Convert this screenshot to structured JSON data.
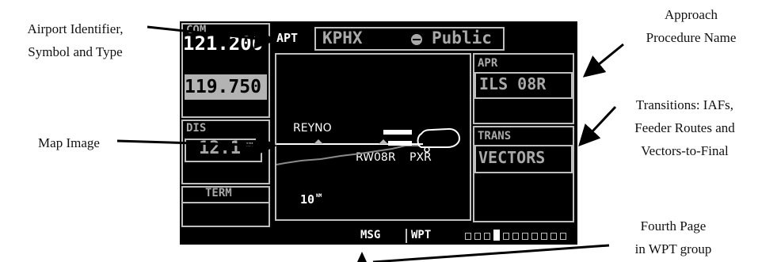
{
  "callouts": {
    "airport_id_line1": "Airport Identifier,",
    "airport_id_line2": "Symbol and Type",
    "map_image": "Map Image",
    "approach_line1": "Approach",
    "approach_line2": "Procedure Name",
    "transitions_line1": "Transitions: IAFs,",
    "transitions_line2": "Feeder Routes and",
    "transitions_line3": "Vectors-to-Final",
    "fourth_page_line1": "Fourth Page",
    "fourth_page_line2": "in WPT group"
  },
  "gps": {
    "left": {
      "com_label": "COM",
      "com_active": "121.200",
      "com_standby": "119.750",
      "dis_label": "DIS",
      "dis_value": "12.1",
      "dis_unit": "NM",
      "term_label": "TERM"
    },
    "apt_label": "APT",
    "airport_ident": "KPHX",
    "airport_type": "Public",
    "apr_label": "APR",
    "approach_name": "ILS 08R",
    "trans_label": "TRANS",
    "transition": "VECTORS",
    "map": {
      "waypoint_reyno": "REYNO",
      "waypoint_runway": "RW08R",
      "waypoint_pxr": "PXR",
      "range_value": "10",
      "range_unit": "NM"
    },
    "status": {
      "msg": "MSG",
      "group": "WPT",
      "page_count": 11,
      "current_page": 4
    }
  },
  "colors": {
    "screen_bg": "#000000",
    "lcd_text": "#ffffff",
    "lcd_dim": "#a9a9a9",
    "frame": "#bfbfbf"
  }
}
